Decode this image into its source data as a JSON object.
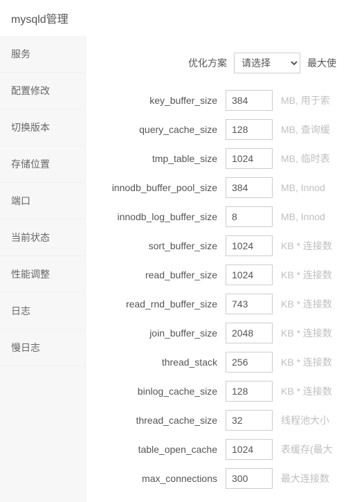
{
  "header": {
    "title": "mysqld管理"
  },
  "sidebar": {
    "items": [
      {
        "label": "服务"
      },
      {
        "label": "配置修改"
      },
      {
        "label": "切换版本"
      },
      {
        "label": "存储位置"
      },
      {
        "label": "端口"
      },
      {
        "label": "当前状态"
      },
      {
        "label": "性能调整"
      },
      {
        "label": "日志"
      },
      {
        "label": "慢日志"
      }
    ]
  },
  "toolbar": {
    "plan_label": "优化方案",
    "plan_selected": "请选择",
    "max_button": "最大使"
  },
  "settings": [
    {
      "key": "key_buffer_size",
      "value": "384",
      "hint": "MB, 用于索"
    },
    {
      "key": "query_cache_size",
      "value": "128",
      "hint": "MB, 查询缓"
    },
    {
      "key": "tmp_table_size",
      "value": "1024",
      "hint": "MB, 临时表"
    },
    {
      "key": "innodb_buffer_pool_size",
      "value": "384",
      "hint": "MB, Innod"
    },
    {
      "key": "innodb_log_buffer_size",
      "value": "8",
      "hint": "MB, Innod"
    },
    {
      "key": "sort_buffer_size",
      "value": "1024",
      "hint": "KB * 连接数"
    },
    {
      "key": "read_buffer_size",
      "value": "1024",
      "hint": "KB * 连接数"
    },
    {
      "key": "read_rnd_buffer_size",
      "value": "743",
      "hint": "KB * 连接数"
    },
    {
      "key": "join_buffer_size",
      "value": "2048",
      "hint": "KB * 连接数"
    },
    {
      "key": "thread_stack",
      "value": "256",
      "hint": "KB * 连接数"
    },
    {
      "key": "binlog_cache_size",
      "value": "128",
      "hint": "KB * 连接数"
    },
    {
      "key": "thread_cache_size",
      "value": "32",
      "hint": "线程池大小"
    },
    {
      "key": "table_open_cache",
      "value": "1024",
      "hint": "表缓存(最大"
    },
    {
      "key": "max_connections",
      "value": "300",
      "hint": "最大连接数"
    }
  ]
}
